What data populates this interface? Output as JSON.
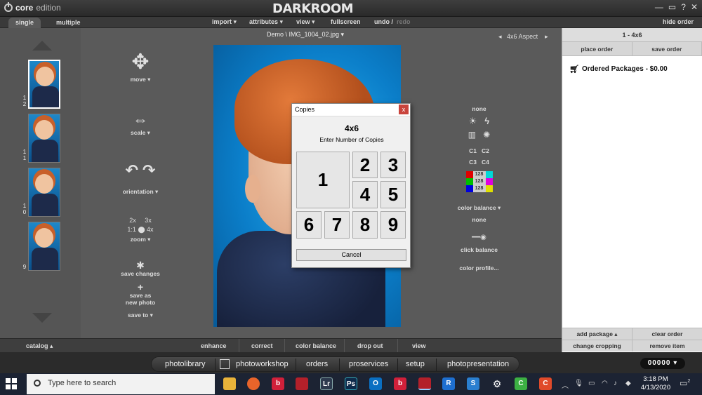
{
  "titlebar": {
    "brand_bold": "core",
    "brand_light": "edition",
    "app_title": "DARKROOM",
    "win_controls": [
      "—",
      "▭",
      "?",
      "✕"
    ]
  },
  "menubar": {
    "tabs": [
      "single",
      "multiple"
    ],
    "items": [
      "import ▾",
      "attributes ▾",
      "view ▾",
      "fullscreen",
      "undo /"
    ],
    "redo": "redo",
    "hide_order": "hide order"
  },
  "thumbnails": [
    {
      "label_a": "1",
      "label_b": "2"
    },
    {
      "label_a": "1",
      "label_b": "1"
    },
    {
      "label_a": "1",
      "label_b": "0"
    },
    {
      "label_a": "9",
      "label_b": ""
    }
  ],
  "tools": {
    "move": "move ▾",
    "scale": "scale ▾",
    "orientation": "orientation ▾",
    "zoom_2x": "2x",
    "zoom_3x": "3x",
    "zoom_11": "1:1",
    "zoom_4x": "4x",
    "zoom": "zoom ▾",
    "save_changes": "save changes",
    "save_as": "save as",
    "new_photo": "new photo",
    "save_to": "save to ▾"
  },
  "center": {
    "file_label": "Demo \\ IMG_1004_02.jpg ▾",
    "aspect_prev": "◂",
    "aspect_text": "4x6  Aspect",
    "aspect_next": "▸"
  },
  "right_tools": {
    "none_top": "none",
    "c1": "C1",
    "c2": "C2",
    "c3": "C3",
    "c4": "C4",
    "balance_value": "128",
    "color_balance": "color balance ▾",
    "none_mid": "none",
    "click_balance": "click balance",
    "color_profile": "color profile..."
  },
  "dialog": {
    "title": "Copies",
    "close": "x",
    "heading": "4x6",
    "subheading": "Enter Number of Copies",
    "keys": [
      "1",
      "2",
      "3",
      "4",
      "5",
      "6",
      "7",
      "8",
      "9"
    ],
    "cancel": "Cancel"
  },
  "order_panel": {
    "header": "1 - 4x6",
    "place_order": "place order",
    "save_order": "save order",
    "ordered_packages": "Ordered Packages - $0.00",
    "add_package": "add package ▴",
    "clear_order": "clear order",
    "change_cropping": "change cropping",
    "remove_item": "remove item"
  },
  "bottom_tabs": {
    "catalog": "catalog ▴",
    "items": [
      "enhance",
      "correct",
      "color balance",
      "drop out",
      "view"
    ]
  },
  "modules": {
    "items": [
      "photolibrary",
      "photoworkshop",
      "orders",
      "proservices",
      "setup",
      "photopresentation"
    ],
    "counter": "00000 ▾"
  },
  "taskbar": {
    "search_placeholder": "Type here to search",
    "time": "3:18 PM",
    "date": "4/13/2020",
    "notifications": "2"
  },
  "colors": {
    "red": "#e00000",
    "green": "#00c000",
    "blue": "#0000e0",
    "cyan": "#00d8d8",
    "magenta": "#e000e0",
    "yellow": "#e0e000"
  }
}
